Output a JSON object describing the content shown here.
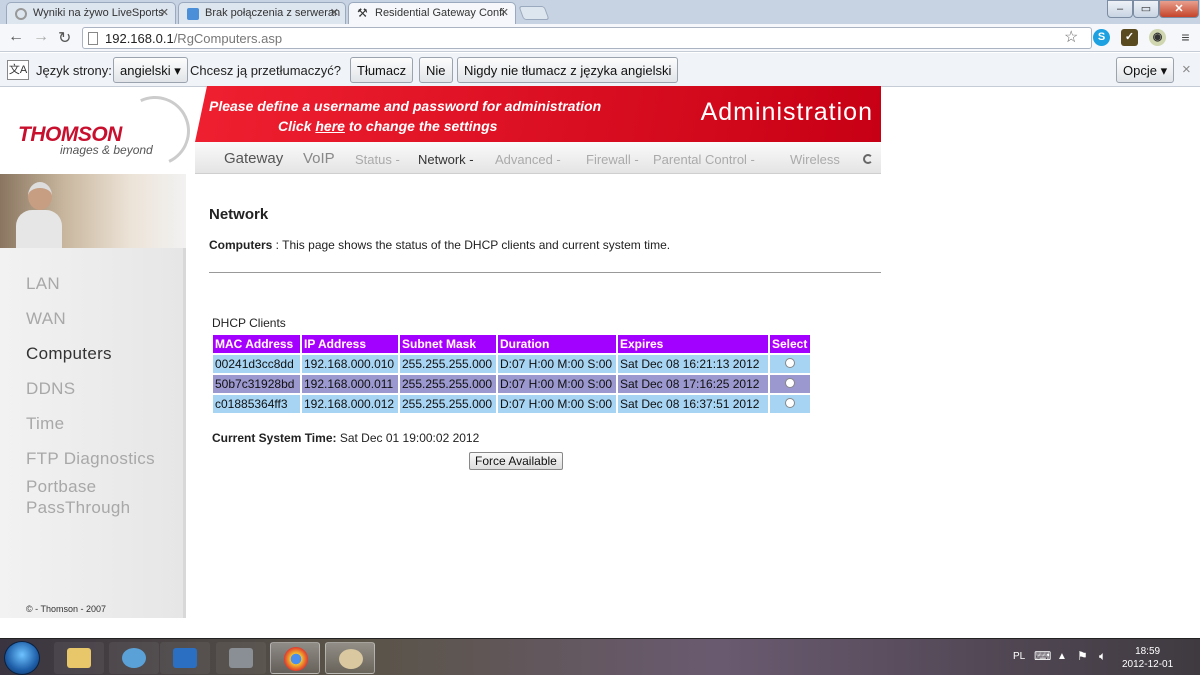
{
  "browser": {
    "tabs": [
      {
        "title": "Wyniki na żywo LiveSports",
        "active": false
      },
      {
        "title": "Brak połączenia z serweran",
        "active": false
      },
      {
        "title": "Residential Gateway Confi",
        "active": true
      }
    ],
    "url_host": "192.168.0.1",
    "url_path": "/RgComputers.asp",
    "window_buttons": {
      "minimize": "‒",
      "maximize": "▭",
      "close": "✕"
    }
  },
  "translate_bar": {
    "language_label": "Język strony:",
    "language_value": "angielski ▾",
    "question": "Chcesz ją przetłumaczyć?",
    "translate": "Tłumacz",
    "no": "Nie",
    "never": "Nigdy nie tłumacz z języka angielski",
    "options": "Opcje ▾",
    "close": "×"
  },
  "router": {
    "logo": "THOMSON",
    "tagline": "images & beyond",
    "banner_line1": "Please define a username and password for administration",
    "banner_click": "Click",
    "banner_here": "here",
    "banner_rest": "to change the settings",
    "banner_right": "Administration",
    "nav": {
      "gateway": "Gateway",
      "voip": "VoIP",
      "status": "Status -",
      "network": "Network -",
      "advanced": "Advanced -",
      "firewall": "Firewall -",
      "parental": "Parental Control -",
      "wireless": "Wireless"
    },
    "sidebar": {
      "lan": "LAN",
      "wan": "WAN",
      "computers": "Computers",
      "ddns": "DDNS",
      "time": "Time",
      "ftp": "FTP Diagnostics",
      "portbase1": "Portbase",
      "portbase2": "PassThrough",
      "copyright": "© - Thomson - 2007"
    },
    "heading": "Network",
    "desc_label": "Computers",
    "desc_sep": " : ",
    "desc_text": "This page shows the status of the DHCP clients and current system time.",
    "dhcp_title": "DHCP Clients",
    "columns": {
      "mac": "MAC Address",
      "ip": "IP Address",
      "mask": "Subnet Mask",
      "duration": "Duration",
      "expires": "Expires",
      "select": "Select"
    },
    "rows": [
      {
        "mac": "00241d3cc8dd",
        "ip": "192.168.000.010",
        "mask": "255.255.255.000",
        "duration": "D:07 H:00 M:00 S:00",
        "expires": "Sat Dec 08 16:21:13 2012"
      },
      {
        "mac": "50b7c31928bd",
        "ip": "192.168.000.011",
        "mask": "255.255.255.000",
        "duration": "D:07 H:00 M:00 S:00",
        "expires": "Sat Dec 08 17:16:25 2012"
      },
      {
        "mac": "c01885364ff3",
        "ip": "192.168.000.012",
        "mask": "255.255.255.000",
        "duration": "D:07 H:00 M:00 S:00",
        "expires": "Sat Dec 08 16:37:51 2012"
      }
    ],
    "systime_label": "Current System Time:",
    "systime_value": "Sat Dec 01 19:00:02 2012",
    "force_button": "Force Available"
  },
  "taskbar": {
    "lang": "PL",
    "time": "18:59",
    "date": "2012-12-01"
  }
}
